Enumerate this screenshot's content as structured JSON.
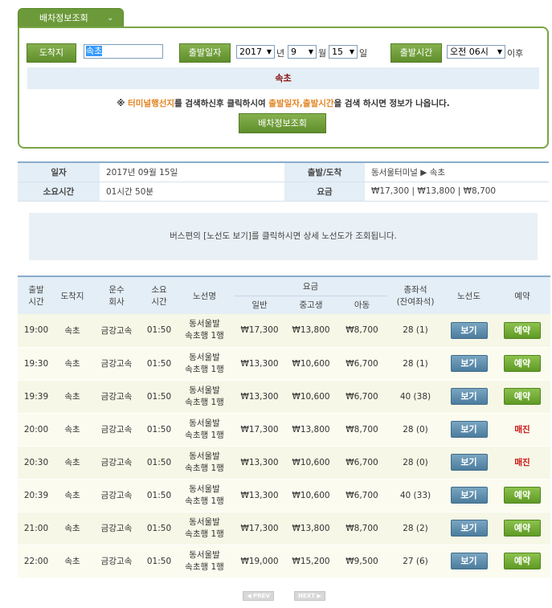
{
  "search": {
    "tab_label": "배차정보조회",
    "tab_chevron": "⌄",
    "dest_label": "도착지",
    "dest_value": "속초",
    "date_label": "출발일자",
    "year": "2017",
    "year_unit": "년",
    "month": "9",
    "month_unit": "월",
    "day": "15",
    "day_unit": "일",
    "time_label": "출발시간",
    "time_value": "오전 06시",
    "time_suffix": "이후",
    "selected_dest": "속초",
    "notice_prefix": "※ ",
    "notice_hl1": "터미널행선지",
    "notice_mid": "를 검색하신후 클릭하시여 ",
    "notice_hl2": "출발일자,출발시간",
    "notice_end": "을 검색 하시면 정보가 나옵니다.",
    "submit_label": "배차정보조회"
  },
  "summary": {
    "date_label": "일자",
    "date_value": "2017년 09월 15일",
    "route_label": "출발/도착",
    "route_value": "동서울터미널 ▶ 속초",
    "duration_label": "소요시간",
    "duration_value": "01시간 50분",
    "fare_label": "요금",
    "fare_value": "₩17,300 | ₩13,800 | ₩8,700"
  },
  "info_text": "버스편의 [노선도 보기]를 클릭하시면 상세 노선도가 조회됩니다.",
  "table": {
    "headers": {
      "dep_time_1": "출발",
      "dep_time_2": "시간",
      "dest": "도착지",
      "company_1": "운수",
      "company_2": "회사",
      "duration_1": "소요",
      "duration_2": "시간",
      "route": "노선명",
      "fare": "요금",
      "fare_adult": "일반",
      "fare_youth": "중고생",
      "fare_child": "아동",
      "seats_1": "총좌석",
      "seats_2": "(잔여좌석)",
      "map": "노선도",
      "reserve": "예약"
    },
    "rows": [
      {
        "time": "19:00",
        "dest": "속초",
        "company": "금강고속",
        "duration": "01:50",
        "route1": "동서울발",
        "route2": "속초행 1행",
        "adult": "₩17,300",
        "youth": "₩13,800",
        "child": "₩8,700",
        "seats": "28 (1)",
        "map": "보기",
        "reserve": "예약"
      },
      {
        "time": "19:30",
        "dest": "속초",
        "company": "금강고속",
        "duration": "01:50",
        "route1": "동서울발",
        "route2": "속초행 1행",
        "adult": "₩13,300",
        "youth": "₩10,600",
        "child": "₩6,700",
        "seats": "28 (1)",
        "map": "보기",
        "reserve": "예약"
      },
      {
        "time": "19:39",
        "dest": "속초",
        "company": "금강고속",
        "duration": "01:50",
        "route1": "동서울발",
        "route2": "속초행 1행",
        "adult": "₩13,300",
        "youth": "₩10,600",
        "child": "₩6,700",
        "seats": "40 (38)",
        "map": "보기",
        "reserve": "예약"
      },
      {
        "time": "20:00",
        "dest": "속초",
        "company": "금강고속",
        "duration": "01:50",
        "route1": "동서울발",
        "route2": "속초행 1행",
        "adult": "₩17,300",
        "youth": "₩13,800",
        "child": "₩8,700",
        "seats": "28 (0)",
        "map": "보기",
        "reserve": "매진"
      },
      {
        "time": "20:30",
        "dest": "속초",
        "company": "금강고속",
        "duration": "01:50",
        "route1": "동서울발",
        "route2": "속초행 1행",
        "adult": "₩13,300",
        "youth": "₩10,600",
        "child": "₩6,700",
        "seats": "28 (0)",
        "map": "보기",
        "reserve": "매진"
      },
      {
        "time": "20:39",
        "dest": "속초",
        "company": "금강고속",
        "duration": "01:50",
        "route1": "동서울발",
        "route2": "속초행 1행",
        "adult": "₩13,300",
        "youth": "₩10,600",
        "child": "₩6,700",
        "seats": "40 (33)",
        "map": "보기",
        "reserve": "예약"
      },
      {
        "time": "21:00",
        "dest": "속초",
        "company": "금강고속",
        "duration": "01:50",
        "route1": "동서울발",
        "route2": "속초행 1행",
        "adult": "₩17,300",
        "youth": "₩13,800",
        "child": "₩8,700",
        "seats": "28 (2)",
        "map": "보기",
        "reserve": "예약"
      },
      {
        "time": "22:00",
        "dest": "속초",
        "company": "금강고속",
        "duration": "01:50",
        "route1": "동서울발",
        "route2": "속초행 1행",
        "adult": "₩19,000",
        "youth": "₩15,200",
        "child": "₩9,500",
        "seats": "27 (6)",
        "map": "보기",
        "reserve": "예약"
      }
    ]
  },
  "pager": {
    "prev": "◀ PREV",
    "next": "NEXT ▶"
  },
  "colors": {
    "green": "#6c9a3a",
    "blue_header": "#e4eef6",
    "soldout": "#cc1111",
    "highlight": "#e28420"
  }
}
